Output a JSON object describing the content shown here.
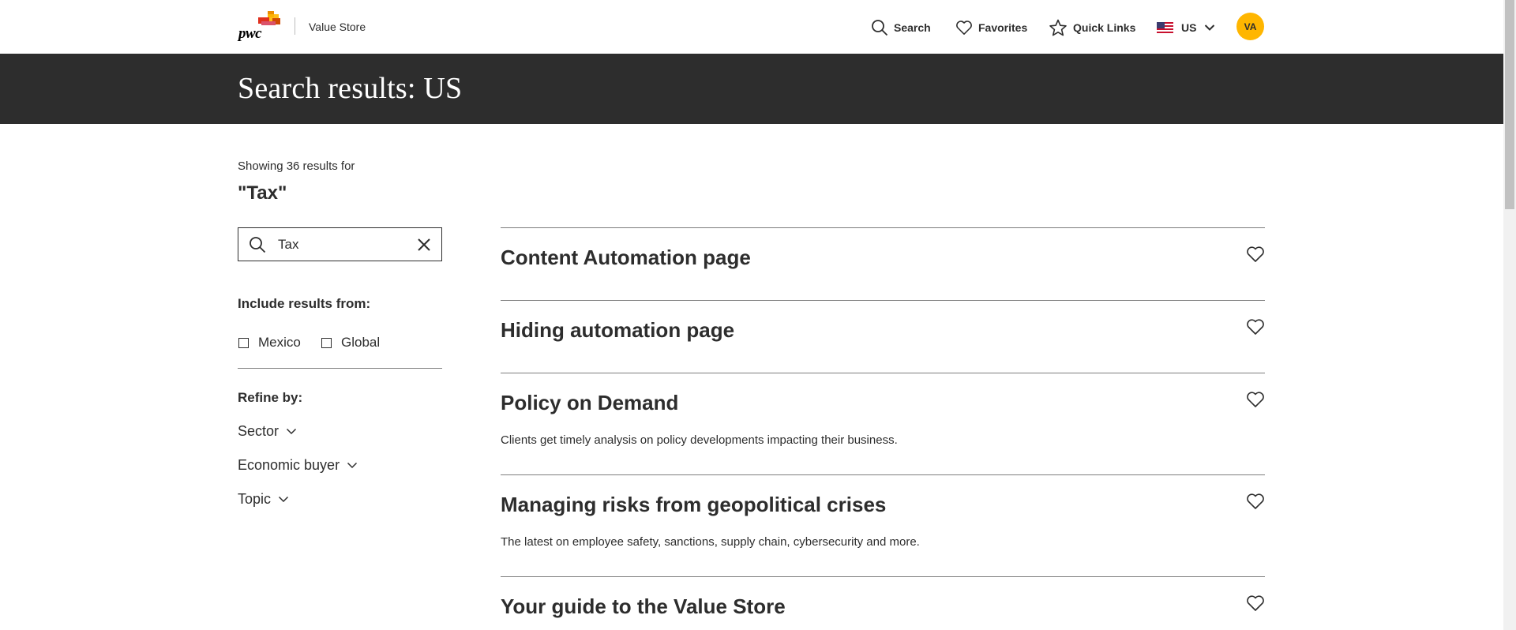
{
  "header": {
    "logo_text": "pwc",
    "brand": "Value Store",
    "nav": {
      "search": "Search",
      "favorites": "Favorites",
      "quick_links": "Quick Links",
      "locale": "US",
      "avatar_initials": "VA"
    }
  },
  "banner": {
    "title": "Search results: US"
  },
  "sidebar": {
    "showing": "Showing 36 results for",
    "query": "\"Tax\"",
    "search": {
      "value": "Tax"
    },
    "include_label": "Include results from:",
    "include_options": [
      "Mexico",
      "Global"
    ],
    "refine_label": "Refine by:",
    "filters": [
      "Sector",
      "Economic buyer",
      "Topic"
    ]
  },
  "results": [
    {
      "title": "Content Automation page",
      "description": ""
    },
    {
      "title": "Hiding automation page",
      "description": ""
    },
    {
      "title": "Policy on Demand",
      "description": "Clients get timely analysis on policy developments impacting their business."
    },
    {
      "title": "Managing risks from geopolitical crises",
      "description": "The latest on employee safety, sanctions, supply chain, cybersecurity and more."
    },
    {
      "title": "Your guide to the Value Store",
      "description": ""
    }
  ],
  "colors": {
    "banner_bg": "#2d2d2d",
    "avatar_bg": "#ffb600",
    "text": "#2d2d2d"
  },
  "icons": [
    "pwc-logo",
    "search-icon",
    "heart-icon",
    "star-icon",
    "us-flag-icon",
    "chevron-down-icon",
    "close-icon"
  ]
}
